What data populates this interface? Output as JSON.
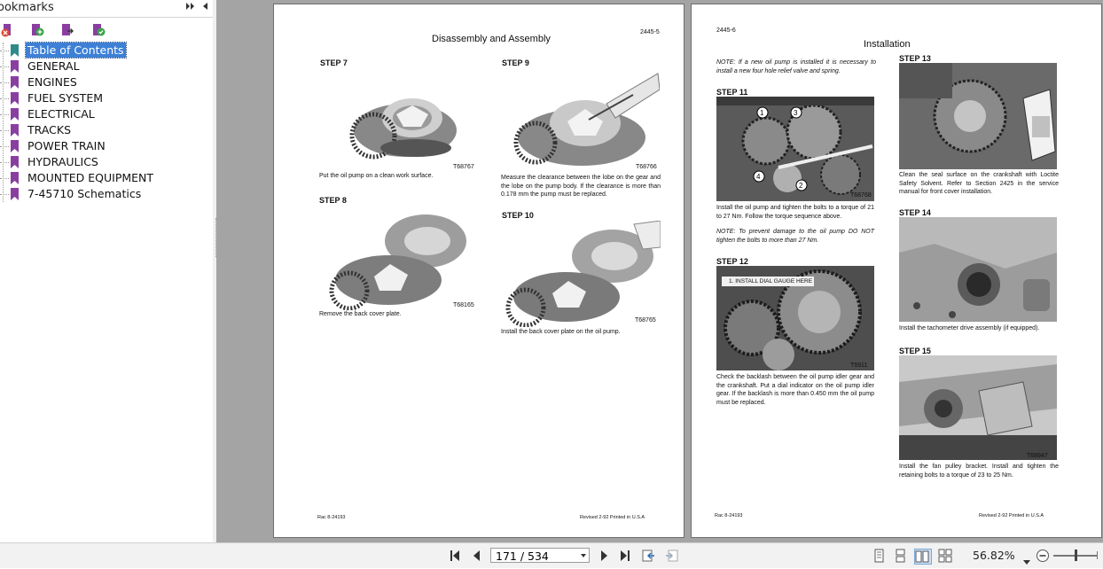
{
  "panel": {
    "title": "ookmarks",
    "items": [
      {
        "label": "Table of Contents",
        "selected": true
      },
      {
        "label": "GENERAL"
      },
      {
        "label": "ENGINES"
      },
      {
        "label": "FUEL SYSTEM"
      },
      {
        "label": "ELECTRICAL"
      },
      {
        "label": "TRACKS"
      },
      {
        "label": "POWER TRAIN"
      },
      {
        "label": "HYDRAULICS"
      },
      {
        "label": "MOUNTED EQUIPMENT"
      },
      {
        "label": "7-45710 Schematics"
      }
    ],
    "toolbar_icons": [
      "delete-bookmark-icon",
      "add-bookmark-icon",
      "goto-bookmark-icon",
      "bookmark-properties-icon"
    ]
  },
  "left_page": {
    "title": "Disassembly and Assembly",
    "page_code": "2445-5",
    "step7": {
      "label": "STEP 7",
      "caption": "Put the oil pump on a clean work surface.",
      "fig": "T68767"
    },
    "step9": {
      "label": "STEP 9",
      "caption": "Measure the clearance between the lobe on the gear and the lobe on the pump body. If the clearance is more than 0.178 mm the pump must be replaced.",
      "fig": "T68766"
    },
    "step8": {
      "label": "STEP 8",
      "caption": "Remove the back cover plate.",
      "fig": "T68165"
    },
    "step10": {
      "label": "STEP 10",
      "caption": "Install the back cover plate on the oil pump.",
      "fig": "T68765"
    },
    "footer_left": "Rac 8-24193",
    "footer_right": "Revised 2-92     Printed in U.S.A"
  },
  "right_page": {
    "page_code": "2445-6",
    "title": "Installation",
    "note1": "NOTE: If a new oil pump is installed it is necessary to install a new four hole relief valve and spring.",
    "step11": {
      "label": "STEP 11",
      "caption": "Install the oil pump and tighten the bolts to a torque of 21 to 27 Nm. Follow the torque sequence above.",
      "fig": "T68768"
    },
    "note2": "NOTE: To prevent damage to the oil pump DO NOT tighten the bolts to more than 27 Nm.",
    "step12": {
      "label": "STEP 12",
      "callout": "1. INSTALL DIAL GAUGE HERE",
      "caption": "Check the backlash between the oil pump idler gear and the crankshaft. Put a dial indicator on the oil pump idler gear. If the backlash is more than 0.450 mm the oil pump must be replaced.",
      "fig": "T6911"
    },
    "step13": {
      "label": "STEP 13",
      "caption": "Clean the seal surface on the crankshaft with Loctite Safety Solvent. Refer to Section 2425 in the service manual for front cover installation."
    },
    "step14": {
      "label": "STEP 14",
      "caption": "Install the tachometer drive assembly (if equipped)."
    },
    "step15": {
      "label": "STEP 15",
      "caption": "Install the fan pulley bracket. Install and tighten the retaining bolts to a torque of 23 to 25 Nm.",
      "fig": "T68947"
    },
    "footer_left": "Rac 8-24193",
    "footer_right": "Revised 2-92     Printed in U.S.A"
  },
  "navbar": {
    "page_display": "171 / 534",
    "zoom": "56.82%"
  }
}
